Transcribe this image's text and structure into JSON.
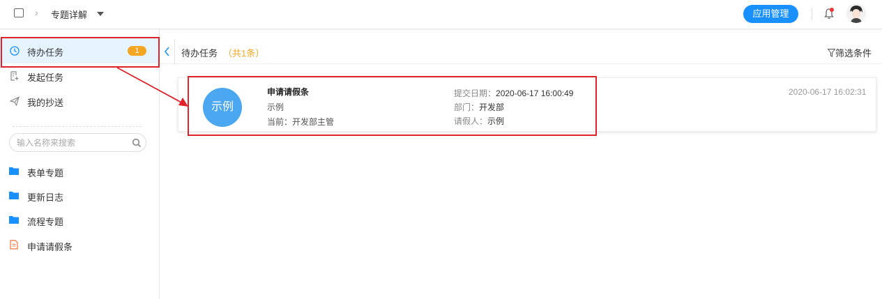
{
  "topbar": {
    "title": "专题详解",
    "app_button": "应用管理"
  },
  "sidebar": {
    "nav": [
      {
        "label": "待办任务",
        "badge": "1"
      },
      {
        "label": "发起任务"
      },
      {
        "label": "我的抄送"
      }
    ],
    "search_placeholder": "输入名称来搜索",
    "tree": [
      {
        "label": "表单专题"
      },
      {
        "label": "更新日志"
      },
      {
        "label": "流程专题"
      },
      {
        "label": "申请请假条"
      }
    ]
  },
  "content": {
    "title": "待办任务",
    "count": "（共1条）",
    "filter": "筛选条件"
  },
  "task_card": {
    "avatar_text": "示例",
    "title": "申请请假条",
    "subtitle": "示例",
    "current": "当前：开发部主管",
    "submit_key": "提交日期：",
    "submit_value": "2020-06-17 16:00:49",
    "dept_key": "部门：",
    "dept_value": "开发部",
    "leave_key": "请假人：",
    "leave_value": "示例",
    "time": "2020-06-17 16:02:31"
  },
  "colors": {
    "primary": "#1890ff",
    "badge": "#f5a623",
    "avatar_circle": "#4aa7f0",
    "highlight": "#e0222a"
  }
}
